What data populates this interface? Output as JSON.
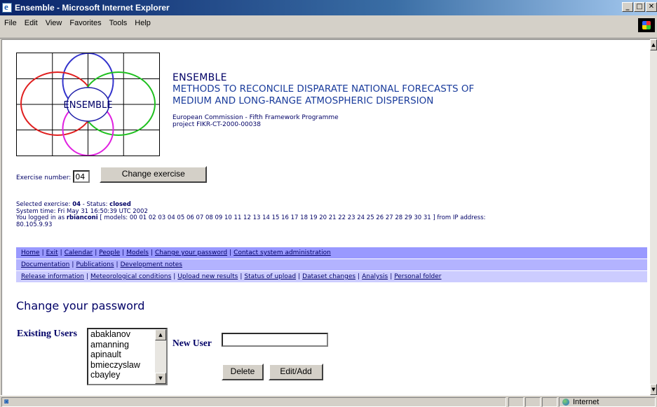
{
  "window": {
    "title": "Ensemble - Microsoft Internet Explorer",
    "minimize": "_",
    "maximize": "□",
    "close": "✕"
  },
  "menu": [
    {
      "label": "File",
      "u": "F"
    },
    {
      "label": "Edit",
      "u": "E"
    },
    {
      "label": "View",
      "u": "V"
    },
    {
      "label": "Favorites",
      "u": "a"
    },
    {
      "label": "Tools",
      "u": "T"
    },
    {
      "label": "Help",
      "u": "H"
    }
  ],
  "logo": {
    "text": "ENSEMBLE"
  },
  "header": {
    "title": "ENSEMBLE",
    "subtitle_line1": "METHODS TO RECONCILE DISPARATE NATIONAL FORECASTS OF",
    "subtitle_line2": "MEDIUM AND LONG-RANGE ATMOSPHERIC DISPERSION",
    "program": "European Commission - Fifth Framework Programme",
    "project": "project FIKR-CT-2000-00038"
  },
  "exercise": {
    "label": "Exercise number:",
    "value": "04",
    "button": "Change exercise"
  },
  "info": {
    "selected_prefix": "Selected exercise: ",
    "selected_value": "04",
    "status_prefix": " - Status: ",
    "status_value": "closed",
    "system_time": "System time: Fri May 31 16:50:39 UTC 2002",
    "logged_prefix": "You logged in as ",
    "user": "rbianconi",
    "models_text": " [ models: 00 01 02 03 04 05 06 07 08 09 10 11 12 13 14 15 16 17 18 19 20 21 22 23 24 25 26 27 28 29 30 31 ] from IP address:",
    "ip": "80.105.9.93"
  },
  "nav": {
    "row1": [
      "Home",
      "Exit",
      "Calendar",
      "People",
      "Models",
      "Change your password",
      "Contact system administration"
    ],
    "row2": [
      "Documentation",
      "Publications",
      "Development notes"
    ],
    "row3": [
      "Release information",
      "Meteorological conditions",
      "Upload new results",
      "Status of upload",
      "Dataset changes",
      "Analysis",
      "Personal folder"
    ]
  },
  "colors": {
    "nav_row1": "#9999ff",
    "nav_row2": "#b3b3ff",
    "nav_row3": "#ccccff",
    "text_navy": "#000066"
  },
  "page": {
    "title": "Change your password",
    "existing_users_label": "Existing Users",
    "users": [
      "abaklanov",
      "amanning",
      "apinault",
      "bmieczyslaw",
      "cbayley"
    ],
    "new_user_label": "New User",
    "new_user_value": "",
    "delete_button": "Delete",
    "edit_button": "Edit/Add"
  },
  "status": {
    "zone": "Internet",
    "zone_icon": "globe-icon"
  }
}
